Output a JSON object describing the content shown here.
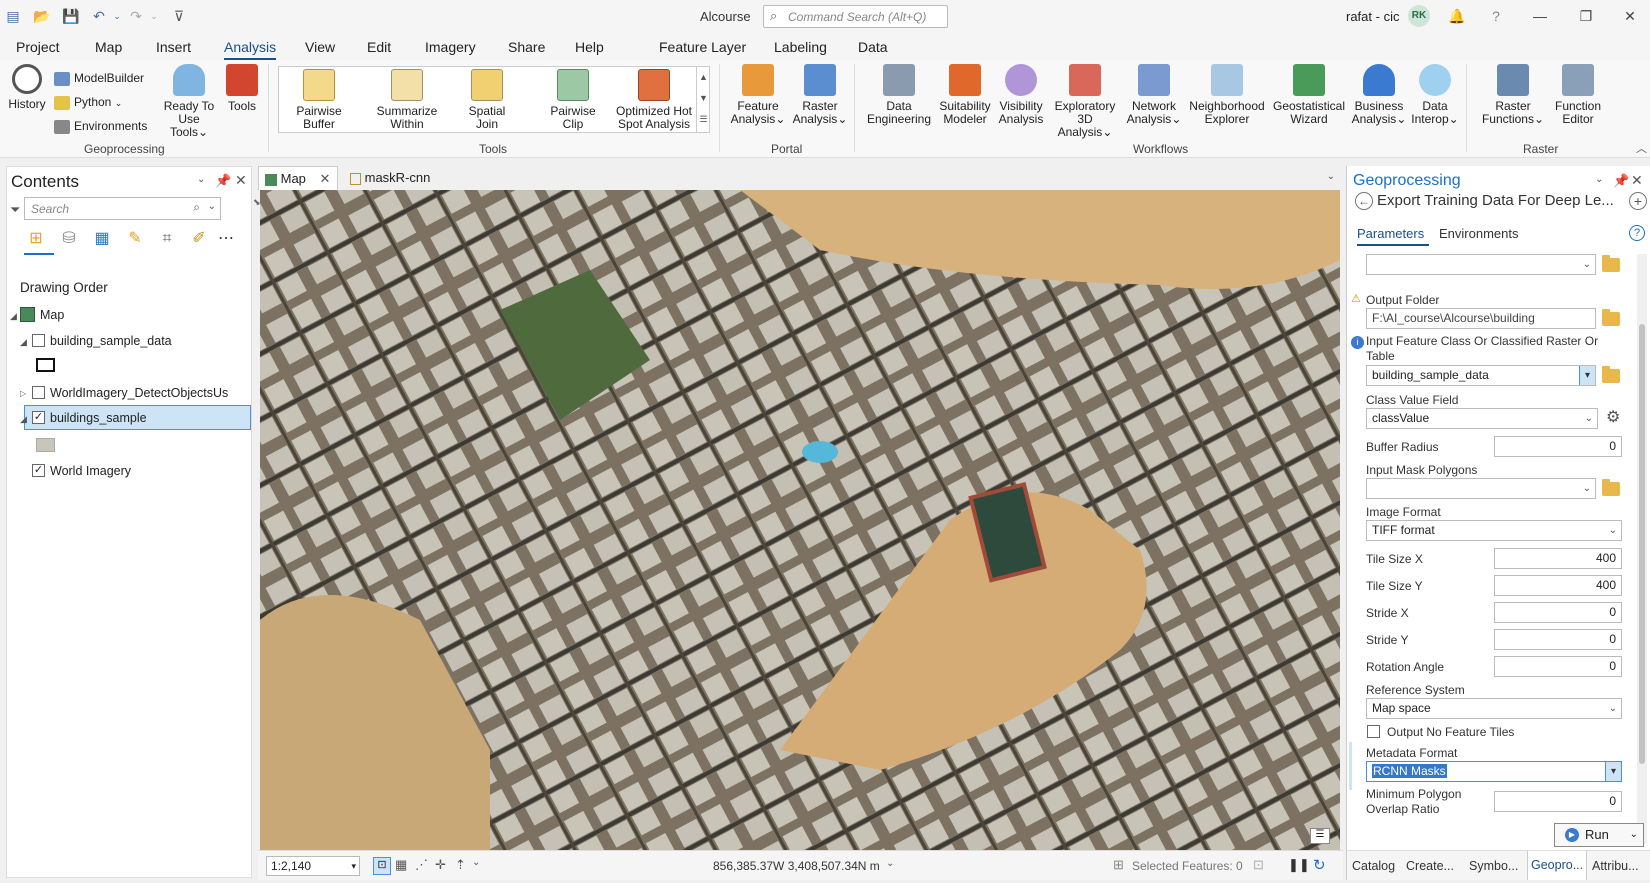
{
  "titlebar": {
    "app_title": "Alcourse",
    "search_placeholder": "Command Search (Alt+Q)",
    "user_name": "rafat - cic",
    "avatar_initials": "RK",
    "help": "?"
  },
  "menu": {
    "items": [
      "Project",
      "Map",
      "Insert",
      "Analysis",
      "View",
      "Edit",
      "Imagery",
      "Share",
      "Help"
    ],
    "context_tabs": [
      "Feature Layer",
      "Labeling",
      "Data"
    ],
    "active": "Analysis"
  },
  "ribbon": {
    "geoprocessing": {
      "history": "History",
      "modelbuilder": "ModelBuilder",
      "python": "Python",
      "environments": "Environments",
      "ready_to_use_1": "Ready To",
      "ready_to_use_2": "Use Tools",
      "tools": "Tools",
      "label": "Geoprocessing"
    },
    "tools": {
      "items": [
        {
          "l1": "Pairwise",
          "l2": "Buffer"
        },
        {
          "l1": "Summarize",
          "l2": "Within"
        },
        {
          "l1": "Spatial",
          "l2": "Join"
        },
        {
          "l1": "Pairwise",
          "l2": "Clip"
        },
        {
          "l1": "Optimized Hot",
          "l2": "Spot Analysis"
        }
      ],
      "label": "Tools"
    },
    "portal": {
      "feature_1": "Feature",
      "feature_2": "Analysis",
      "raster_1": "Raster",
      "raster_2": "Analysis",
      "label": "Portal"
    },
    "workflows": {
      "items": [
        {
          "l1": "Data",
          "l2": "Engineering"
        },
        {
          "l1": "Suitability",
          "l2": "Modeler"
        },
        {
          "l1": "Visibility",
          "l2": "Analysis"
        },
        {
          "l1": "Exploratory",
          "l2": "3D Analysis"
        },
        {
          "l1": "Network",
          "l2": "Analysis"
        },
        {
          "l1": "Neighborhood",
          "l2": "Explorer"
        },
        {
          "l1": "Geostatistical",
          "l2": "Wizard"
        },
        {
          "l1": "Business",
          "l2": "Analysis"
        },
        {
          "l1": "Data",
          "l2": "Interop"
        }
      ],
      "label": "Workflows"
    },
    "raster": {
      "fn_1": "Raster",
      "fn_2": "Functions",
      "ed_1": "Function",
      "ed_2": "Editor",
      "label": "Raster"
    }
  },
  "contents": {
    "title": "Contents",
    "search_placeholder": "Search",
    "drawing_order": "Drawing Order",
    "map": "Map",
    "layers": [
      {
        "name": "building_sample_data",
        "checked": false
      },
      {
        "name": "WorldImagery_DetectObjectsUs",
        "checked": false
      },
      {
        "name": "buildings_sample",
        "checked": true
      },
      {
        "name": "World Imagery",
        "checked": true
      }
    ]
  },
  "map_tabs": [
    "Map",
    "maskR-cnn"
  ],
  "status": {
    "scale": "1:2,140",
    "coords": "856,385.37W 3,408,507.34N m",
    "selected": "Selected Features: 0"
  },
  "geoprocessing": {
    "title": "Geoprocessing",
    "tool_title": "Export Training Data For Deep Le...",
    "tabs": [
      "Parameters",
      "Environments"
    ],
    "output_folder_label": "Output Folder",
    "output_folder_value": "F:\\AI_course\\Alcourse\\building",
    "input_feature_label_1": "Input Feature Class Or Classified Raster Or",
    "input_feature_label_2": "Table",
    "input_feature_value": "building_sample_data",
    "class_value_label": "Class Value Field",
    "class_value_value": "classValue",
    "buffer_label": "Buffer Radius",
    "buffer_value": "0",
    "mask_label": "Input Mask Polygons",
    "image_format_label": "Image Format",
    "image_format_value": "TIFF format",
    "tile_x_label": "Tile Size X",
    "tile_x_value": "400",
    "tile_y_label": "Tile Size Y",
    "tile_y_value": "400",
    "stride_x_label": "Stride X",
    "stride_x_value": "0",
    "stride_y_label": "Stride Y",
    "stride_y_value": "0",
    "rotation_label": "Rotation Angle",
    "rotation_value": "0",
    "ref_label": "Reference System",
    "ref_value": "Map space",
    "no_feature_label": "Output No Feature Tiles",
    "metadata_label": "Metadata Format",
    "metadata_value": "RCNN Masks",
    "min_poly_label_1": "Minimum Polygon",
    "min_poly_label_2": "Overlap Ratio",
    "min_poly_value": "0",
    "run": "Run"
  },
  "bottom_tabs": [
    "Catalog",
    "Create...",
    "Symbo...",
    "Geopro...",
    "Attribu..."
  ],
  "colors": {
    "accent": "#1a4f8b",
    "selection": "#cde4f7",
    "metadata_highlight": "#3578c8"
  }
}
